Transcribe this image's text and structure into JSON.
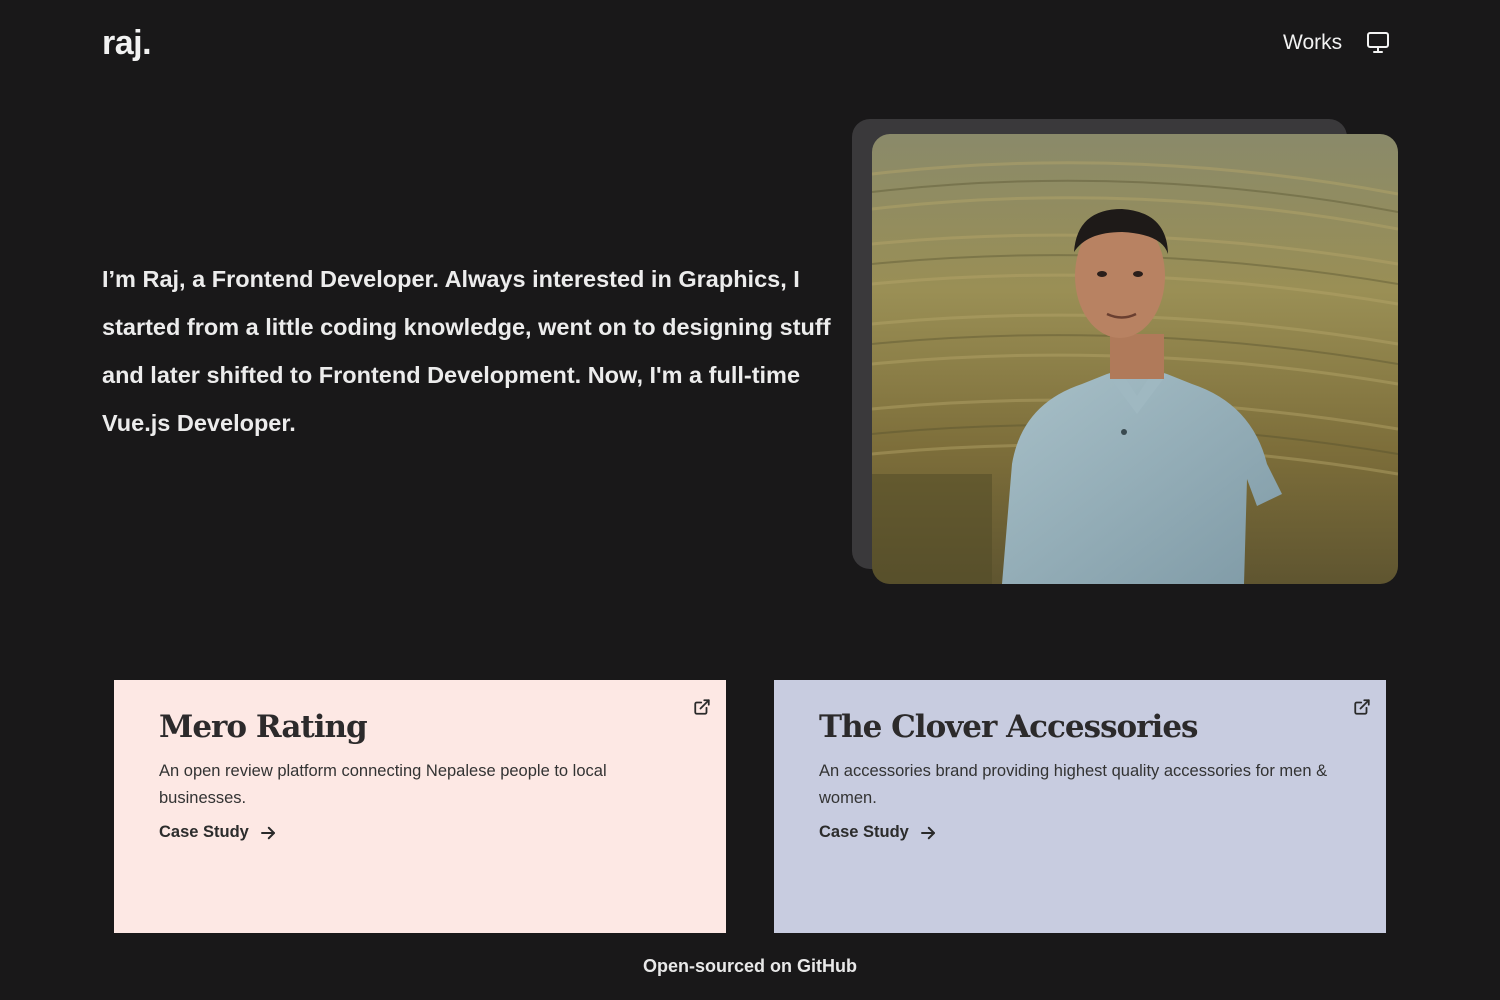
{
  "header": {
    "logo": "raj.",
    "nav_works": "Works",
    "theme_icon": "monitor-icon"
  },
  "hero": {
    "intro": "I’m Raj, a Frontend Developer. Always interested in Graphics, I started from a little coding knowledge, went on to designing stuff and later shifted to Frontend Development. Now, I'm a full-time Vue.js Developer."
  },
  "works": [
    {
      "title": "Mero Rating",
      "description": "An open review platform connecting Nepalese people to local businesses.",
      "link_label": "Case Study",
      "background": "#fde8e4",
      "icons": [
        "external-link-icon",
        "arrow-right-icon"
      ]
    },
    {
      "title": "The Clover Accessories",
      "description": "An accessories brand providing highest quality accessories for men & women.",
      "link_label": "Case Study",
      "background": "#c8cce0",
      "icons": [
        "external-link-icon",
        "arrow-right-icon"
      ]
    }
  ],
  "footer": {
    "link": "Open-sourced on GitHub"
  },
  "colors": {
    "background": "#191819",
    "text": "#eeeeee",
    "photo_backdrop": "#3a393b"
  }
}
